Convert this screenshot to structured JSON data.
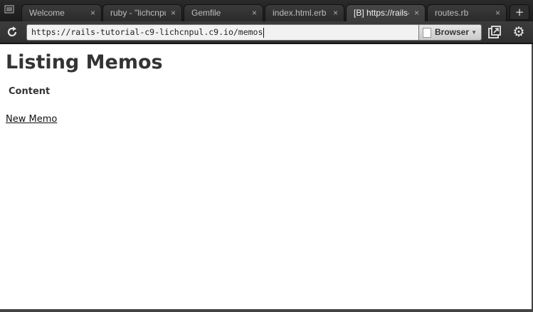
{
  "tabs": [
    {
      "label": "Welcome",
      "close": "×"
    },
    {
      "label": "ruby - \"lichcnpu",
      "close": "×"
    },
    {
      "label": "Gemfile",
      "close": "×"
    },
    {
      "label": "index.html.erb",
      "close": "×"
    },
    {
      "label": "[B] https://rails-",
      "close": "×",
      "active": true
    },
    {
      "label": "routes.rb",
      "close": "×"
    }
  ],
  "tab_new_label": "+",
  "toolbar": {
    "url": "https://rails-tutorial-c9-lichcnpul.c9.io/memos",
    "browser_label": "Browser"
  },
  "page": {
    "title": "Listing Memos",
    "column_header": "Content",
    "new_link": "New Memo"
  }
}
